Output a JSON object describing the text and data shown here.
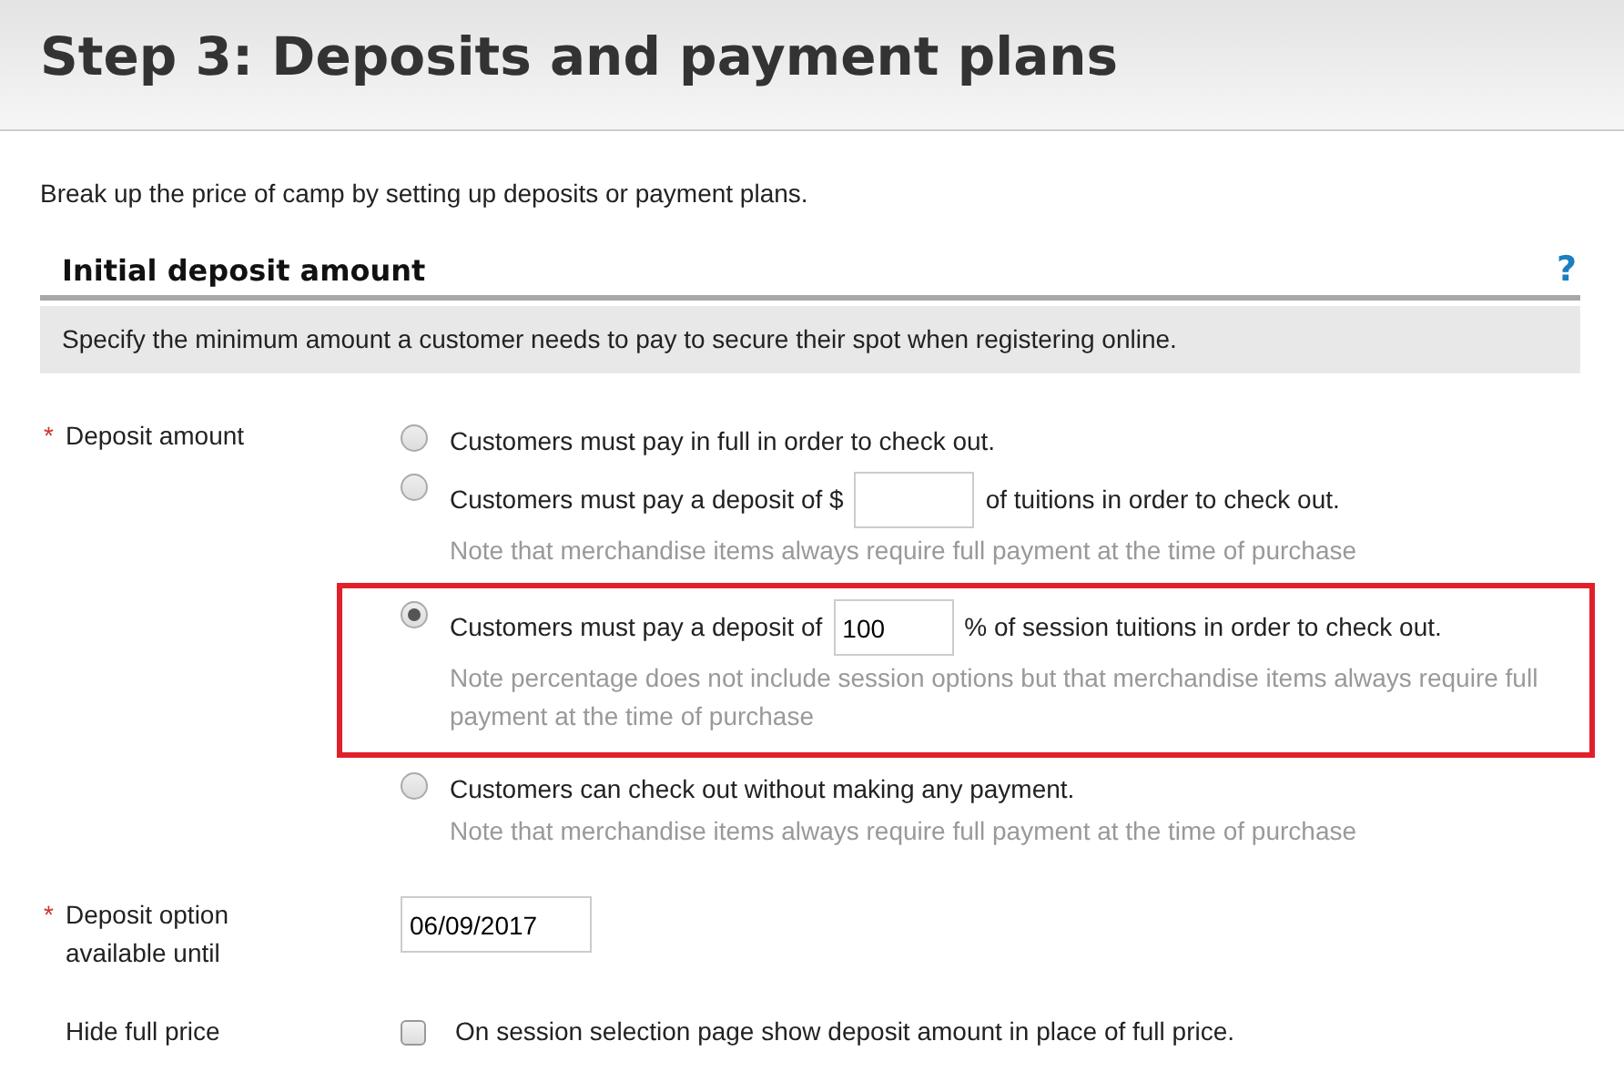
{
  "page_title": "Step 3: Deposits and payment plans",
  "intro": "Break up the price of camp by setting up deposits or payment plans.",
  "section": {
    "title": "Initial deposit amount",
    "help": "?",
    "description": "Specify the minimum amount a customer needs to pay to secure their spot when registering online."
  },
  "deposit_amount": {
    "label": "Deposit amount",
    "required_mark": "*",
    "options": [
      {
        "kind": "plain",
        "selected": false,
        "highlighted": false,
        "text": "Customers must pay in full in order to check out."
      },
      {
        "kind": "input",
        "selected": false,
        "highlighted": false,
        "text_before": "Customers must pay a deposit of $",
        "text_after": "of tuitions in order to check out.",
        "note": "Note that merchandise items always require full payment at the time of purchase"
      },
      {
        "kind": "input",
        "selected": true,
        "highlighted": true,
        "text_before": "Customers must pay a deposit of",
        "value": "100",
        "text_after": "%  of session tuitions in order to check out.",
        "note": "Note percentage does not include session options but that merchandise items always require full payment at the time of purchase"
      },
      {
        "kind": "plain",
        "selected": false,
        "highlighted": false,
        "text": "Customers can check out without making any payment.",
        "note": "Note that merchandise items always require full payment at the time of purchase"
      }
    ]
  },
  "deposit_until": {
    "label": "Deposit option available until",
    "required_mark": "*",
    "value": "06/09/2017"
  },
  "hide_full_price": {
    "label": "Hide full price",
    "checked": false,
    "text": "On session selection page show deposit amount in place of full price."
  }
}
